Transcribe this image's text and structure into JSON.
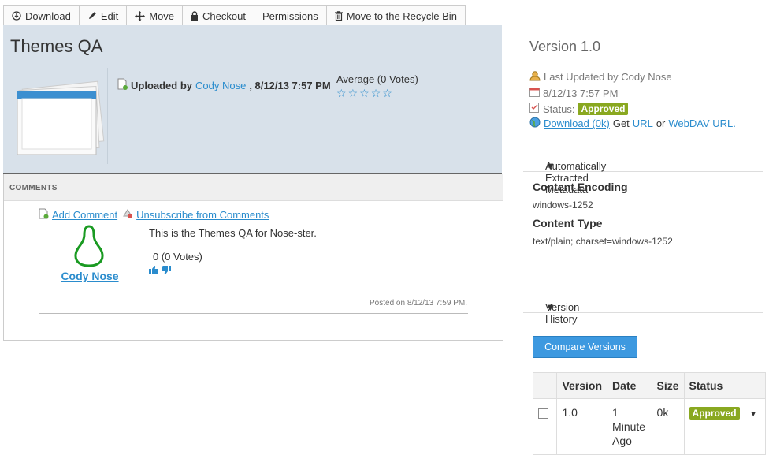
{
  "toolbar": {
    "download": "Download",
    "edit": "Edit",
    "move": "Move",
    "checkout": "Checkout",
    "permissions": "Permissions",
    "recycle": "Move to the Recycle Bin"
  },
  "document": {
    "title": "Themes QA",
    "uploaded_by_label": "Uploaded by",
    "uploader": "Cody Nose",
    "upload_date": ", 8/12/13 7:57 PM",
    "average_votes": "Average (0 Votes)",
    "stars": [
      "☆",
      "☆",
      "☆",
      "☆",
      "☆"
    ]
  },
  "comments": {
    "header": "COMMENTS",
    "add_comment": "Add Comment",
    "unsubscribe": "Unsubscribe from Comments",
    "items": [
      {
        "author": "Cody Nose",
        "text": "This is the Themes QA for Nose-ster.",
        "votes": "0 (0 Votes)",
        "posted": "Posted on 8/12/13 7:59 PM."
      }
    ]
  },
  "version_panel": {
    "title": "Version 1.0",
    "last_updated": "Last Updated by Cody Nose",
    "date": "8/12/13 7:57 PM",
    "status_label": "Status:",
    "status": "Approved",
    "download_link": "Download (0k)",
    "get_text": "Get",
    "url_link": "URL",
    "or_text": "or",
    "webdav_link": "WebDAV URL",
    "period": "."
  },
  "metadata": {
    "header": "Automatically Extracted Metadata",
    "content_encoding_label": "Content Encoding",
    "content_encoding": "windows-1252",
    "content_type_label": "Content Type",
    "content_type": "text/plain; charset=windows-1252"
  },
  "history": {
    "header": "Version History",
    "compare_button": "Compare Versions",
    "columns": [
      "Version",
      "Date",
      "Size",
      "Status"
    ],
    "rows": [
      {
        "version": "1.0",
        "date": "1 Minute Ago",
        "size": "0k",
        "status": "Approved"
      }
    ]
  },
  "colors": {
    "accent": "#2a8ccd",
    "panel_bg": "#d8e1ea",
    "approved": "#89a820",
    "button": "#3d99e0"
  }
}
